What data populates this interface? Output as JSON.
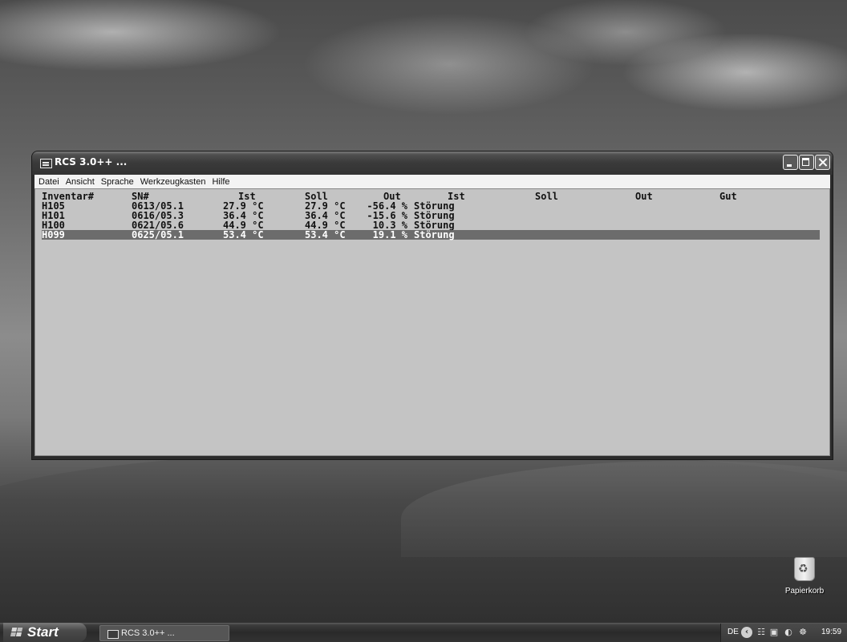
{
  "window": {
    "title": "RCS 3.0++ ...",
    "menu": [
      "Datei",
      "Ansicht",
      "Sprache",
      "Werkzeugkasten",
      "Hilfe"
    ]
  },
  "table": {
    "headers": [
      "Inventar#",
      "SN#",
      "Ist",
      "Soll",
      "Out",
      "Ist",
      "Soll",
      "Out",
      "Gut"
    ],
    "rows": [
      {
        "inventar": "H105",
        "sn": "0613/05.1",
        "ist": "27.9 °C",
        "soll": "27.9 °C",
        "out": "-56.4 %",
        "status": "Störung"
      },
      {
        "inventar": "H101",
        "sn": "0616/05.3",
        "ist": "36.4 °C",
        "soll": "36.4 °C",
        "out": "-15.6 %",
        "status": "Störung"
      },
      {
        "inventar": "H100",
        "sn": "0621/05.6",
        "ist": "44.9 °C",
        "soll": "44.9 °C",
        "out": "10.3 %",
        "status": "Störung"
      },
      {
        "inventar": "H099",
        "sn": "0625/05.1",
        "ist": "53.4 °C",
        "soll": "53.4 °C",
        "out": "19.1 %",
        "status": "Störung"
      }
    ],
    "selected_row": 3
  },
  "desktop": {
    "recycle_bin_label": "Papierkorb"
  },
  "taskbar": {
    "start_label": "Start",
    "task_label": "RCS 3.0++ ...",
    "language": "DE",
    "clock": "19:59"
  }
}
